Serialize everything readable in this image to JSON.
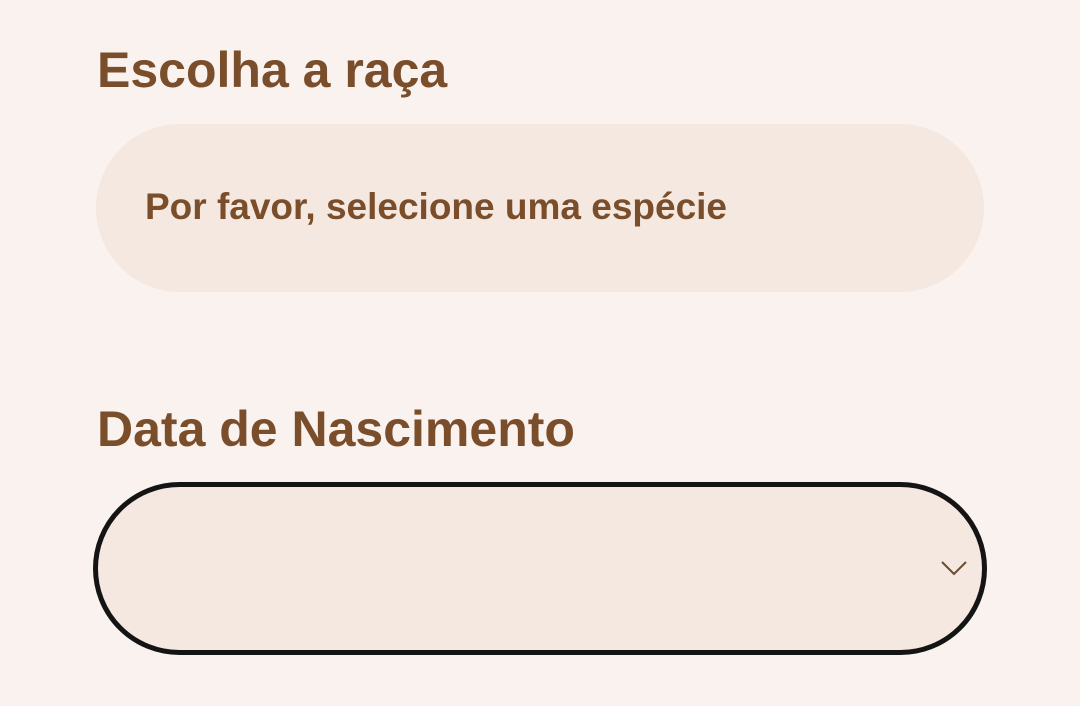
{
  "breed": {
    "label": "Escolha a raça",
    "select_text": "Por favor, selecione uma espécie"
  },
  "birth_date": {
    "label": "Data de Nascimento",
    "value": ""
  },
  "icons": {
    "birth_dropdown": "chevron-down-icon"
  },
  "colors": {
    "background": "#f9f2ee",
    "field_fill": "#f4e8e0",
    "text_brown": "#7a4d2b",
    "focus_border": "#141414"
  }
}
